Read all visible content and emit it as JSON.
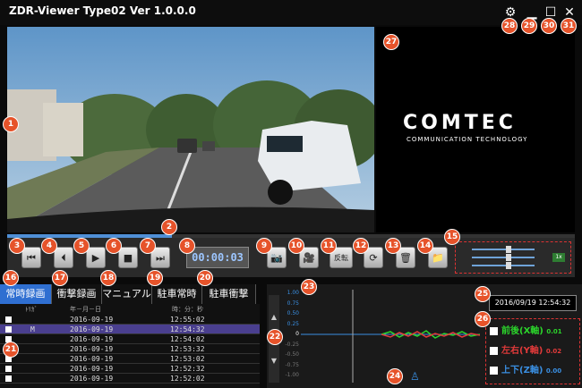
{
  "app": {
    "title": "ZDR-Viewer Type02 Ver 1.0.0.0"
  },
  "brand": {
    "logo": "COMTEC",
    "subtitle": "COMMUNICATION TECHNOLOGY"
  },
  "player": {
    "time": "00:00:03",
    "flip_label": "反転",
    "speed_label": "1x",
    "progress": 0.29
  },
  "tabs": [
    "常時録画",
    "衝撃録画",
    "マニュアル",
    "駐車常時",
    "駐車衝撃"
  ],
  "filelist": {
    "headers": [
      "ﾄﾘｶﾞ",
      "年－月－日",
      "時：分：秒"
    ],
    "rows": [
      {
        "trigger": "",
        "date": "2016-09-19",
        "time": "12:55:02"
      },
      {
        "trigger": "M",
        "date": "2016-09-19",
        "time": "12:54:32"
      },
      {
        "trigger": "",
        "date": "2016-09-19",
        "time": "12:54:02"
      },
      {
        "trigger": "",
        "date": "2016-09-19",
        "time": "12:53:32"
      },
      {
        "trigger": "",
        "date": "2016-09-19",
        "time": "12:53:02"
      },
      {
        "trigger": "",
        "date": "2016-09-19",
        "time": "12:52:32"
      },
      {
        "trigger": "",
        "date": "2016-09-19",
        "time": "12:52:02"
      }
    ]
  },
  "graph": {
    "y_ticks": [
      "1.00",
      "0.75",
      "0.50",
      "0.25",
      "0",
      "-0.25",
      "-0.50",
      "-0.75",
      "-1.00"
    ],
    "datetime": "2016/09/19 12:54:32"
  },
  "legend": [
    {
      "label": "前後(X軸)",
      "value": "0.01",
      "color": "#2bd42b"
    },
    {
      "label": "左右(Y軸)",
      "value": "0.02",
      "color": "#e23a3a"
    },
    {
      "label": "上下(Z軸)",
      "value": "0.00",
      "color": "#3a8fe2"
    }
  ],
  "badges": [
    "1",
    "2",
    "3",
    "4",
    "5",
    "6",
    "7",
    "8",
    "9",
    "10",
    "11",
    "12",
    "13",
    "14",
    "15",
    "16",
    "17",
    "18",
    "19",
    "20",
    "21",
    "22",
    "23",
    "24",
    "25",
    "26",
    "27",
    "28",
    "29",
    "30",
    "31"
  ]
}
